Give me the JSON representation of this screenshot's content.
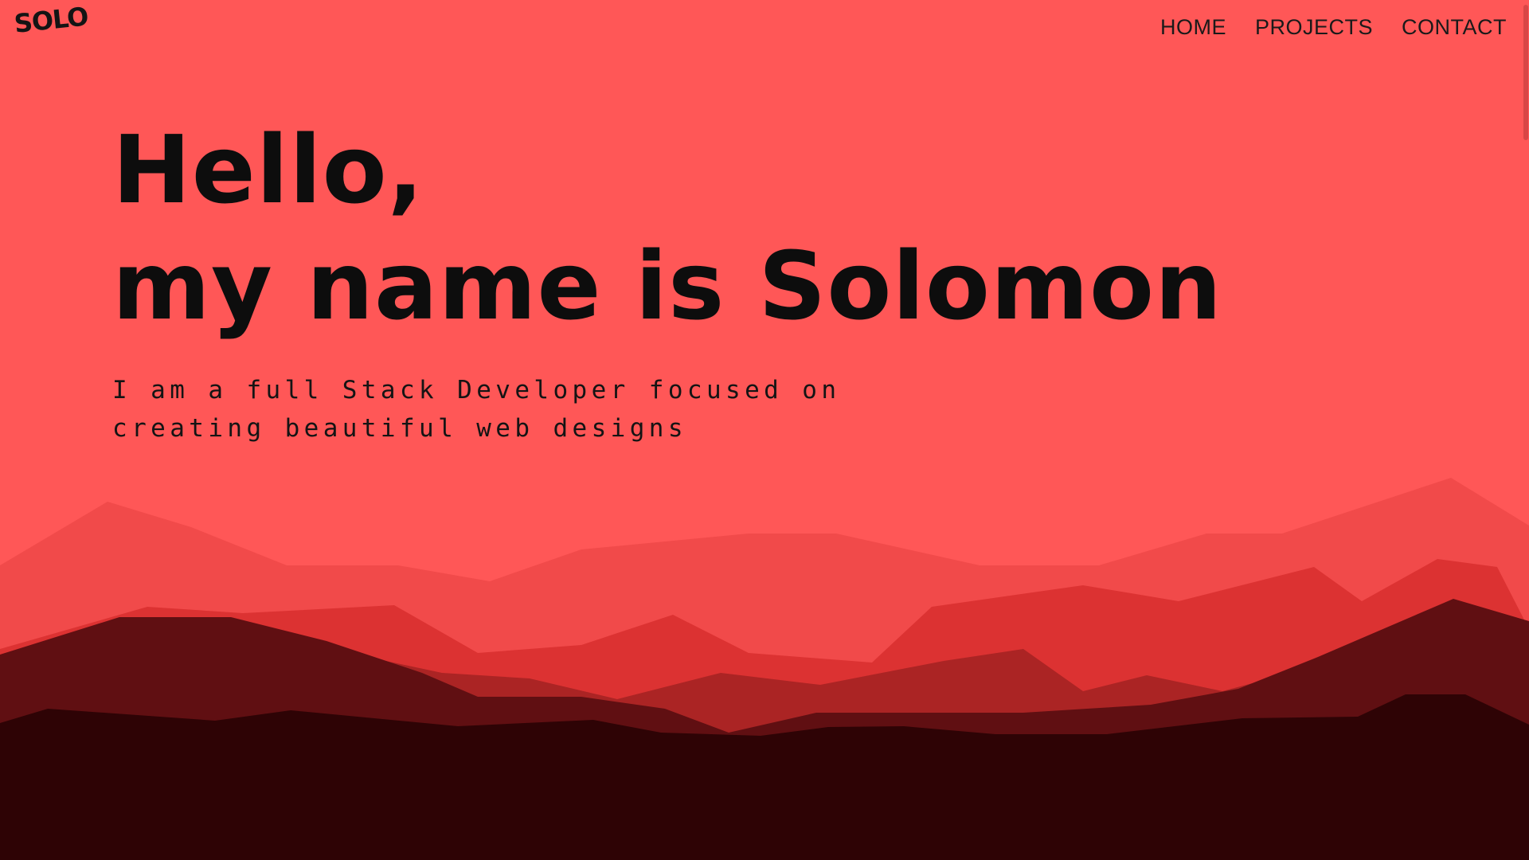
{
  "brand": {
    "logo": "SOLO"
  },
  "nav": {
    "items": [
      {
        "label": "HOME"
      },
      {
        "label": "PROJECTS"
      },
      {
        "label": "CONTACT"
      }
    ]
  },
  "hero": {
    "title_line1": "Hello,",
    "title_line2": "my name is Solomon",
    "subtitle_line1": "I am a full Stack Developer focused on",
    "subtitle_line2": "creating beautiful web designs"
  },
  "colors": {
    "background": "#ff5757",
    "text": "#0d0d0d",
    "mountain_layer_1": "#f14a4a",
    "mountain_layer_2": "#dc3232",
    "mountain_layer_3": "#ab2424",
    "mountain_layer_4": "#600f12",
    "mountain_layer_5": "#2e0305"
  }
}
